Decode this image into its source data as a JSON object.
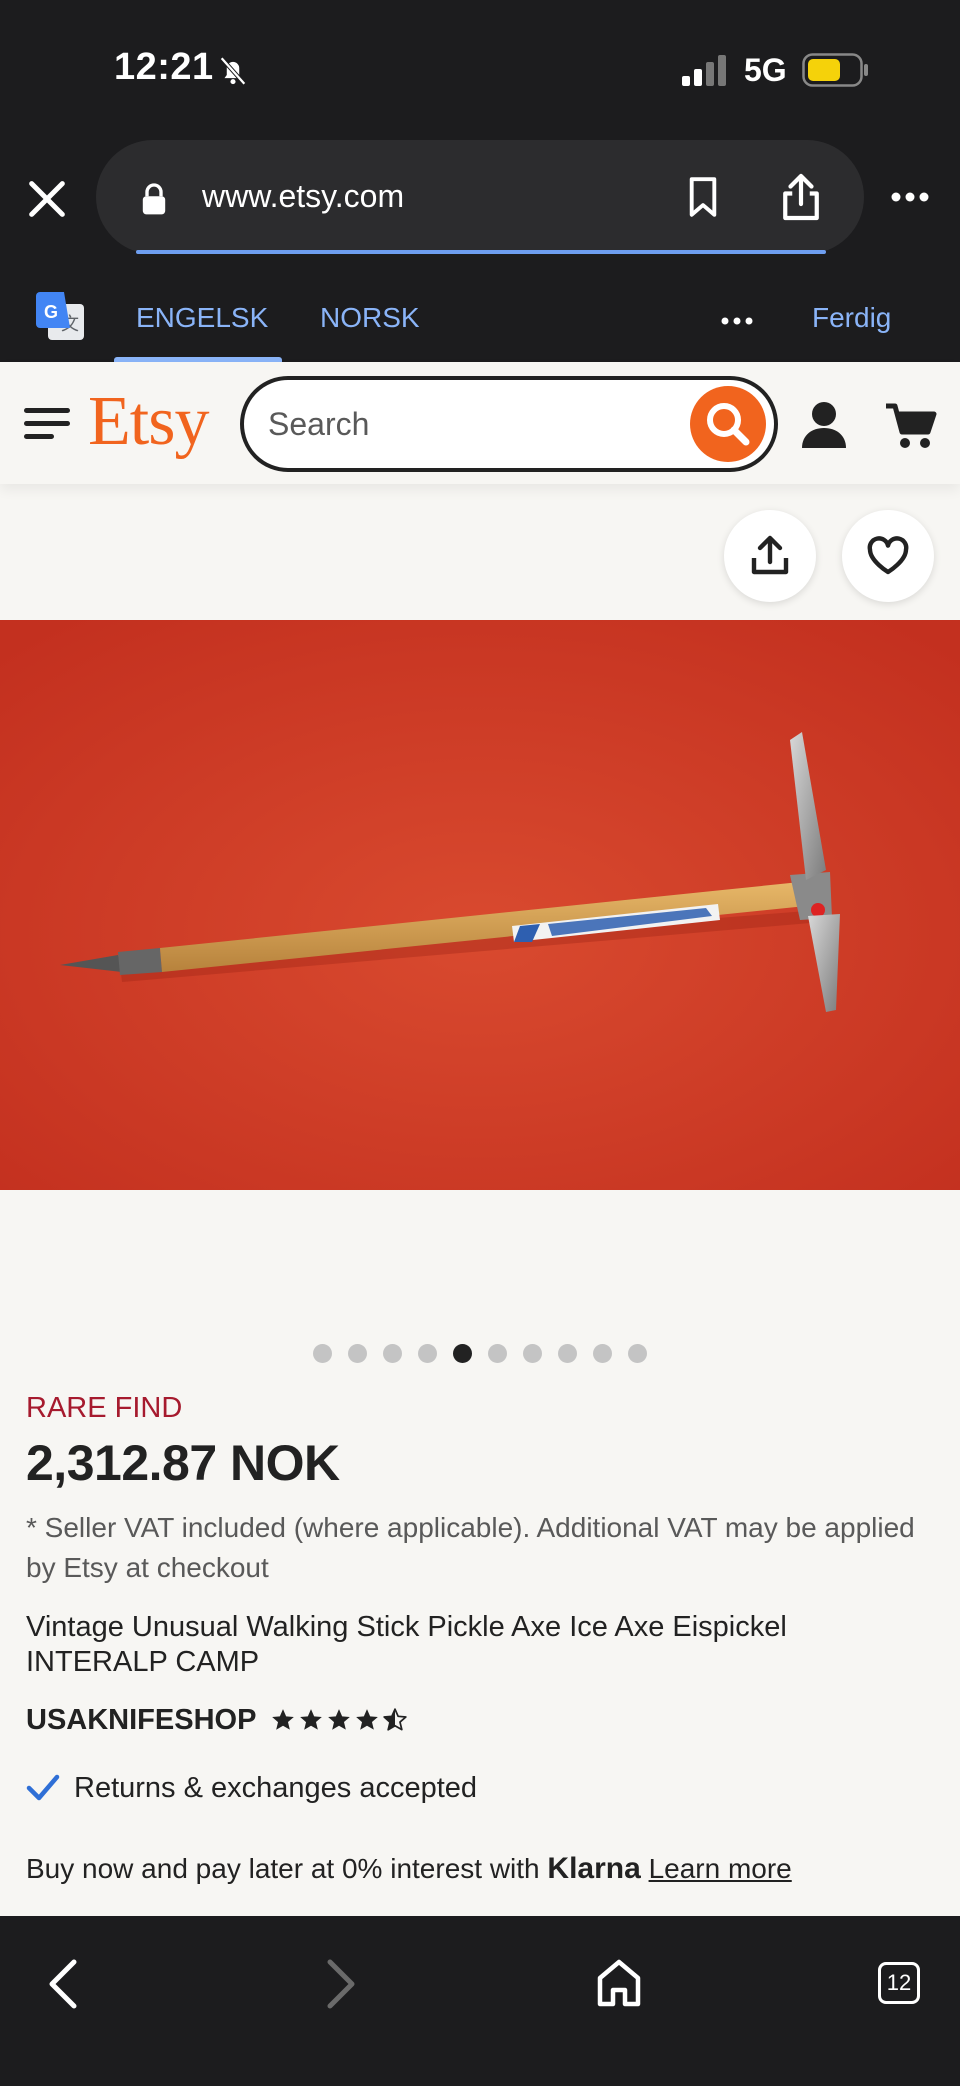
{
  "status_bar": {
    "time": "12:21",
    "network": "5G",
    "icons": [
      "bell-slash-icon",
      "signal-icon",
      "battery-icon"
    ]
  },
  "browser": {
    "url": "www.etsy.com",
    "icons": [
      "close-icon",
      "lock-icon",
      "bookmark-icon",
      "share-icon",
      "more-icon"
    ]
  },
  "translate_bar": {
    "source_lang": "ENGELSK",
    "target_lang": "NORSK",
    "done_label": "Ferdig",
    "accent": "#8ab4f8"
  },
  "etsy_header": {
    "logo": "Etsy",
    "search_placeholder": "Search",
    "brand_color": "#f1641e"
  },
  "gallery": {
    "dot_count": 10,
    "active_index": 4
  },
  "product": {
    "badge": "RARE FIND",
    "price": "2,312.87 NOK",
    "vat_note": "* Seller VAT included (where applicable). Additional VAT may be applied by Etsy at checkout",
    "title": "Vintage Unusual Walking Stick Pickle Axe Ice Axe Eispickel INTERALP CAMP",
    "shop_name": "USAKNIFESHOP",
    "rating": 4.5,
    "returns": "Returns & exchanges accepted",
    "klarna_text": "Buy now and pay later at 0% interest with",
    "klarna_brand": "Klarna",
    "learn_more": "Learn more"
  },
  "bottom_nav": {
    "tab_count": "12"
  }
}
